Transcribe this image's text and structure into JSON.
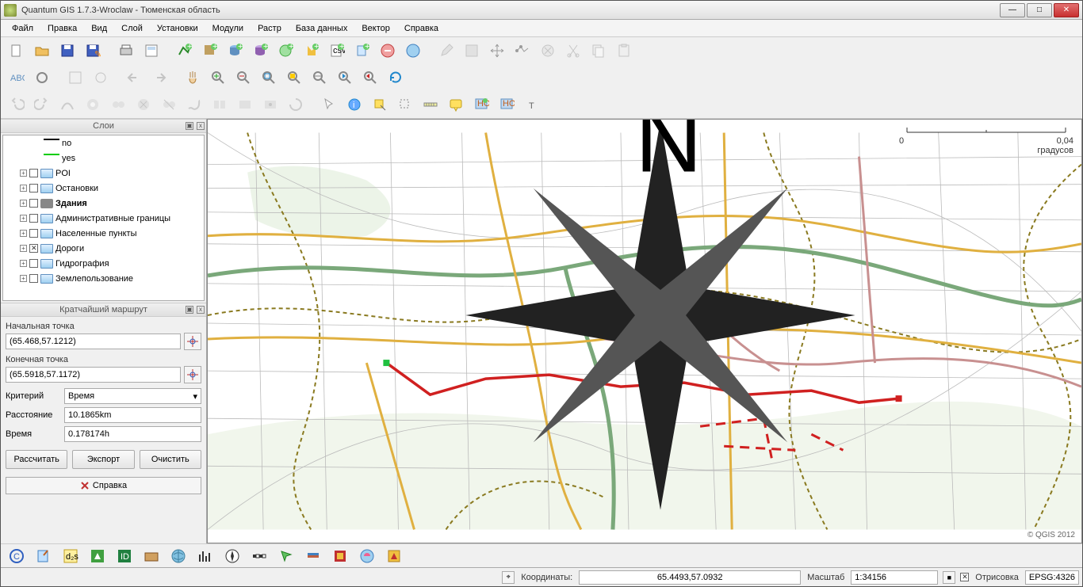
{
  "window": {
    "title": "Quantum GIS 1.7.3-Wroclaw - Тюменская область"
  },
  "menu": [
    "Файл",
    "Правка",
    "Вид",
    "Слой",
    "Установки",
    "Модули",
    "Растр",
    "База данных",
    "Вектор",
    "Справка"
  ],
  "panels": {
    "layers_title": "Слои",
    "route_title": "Кратчайший маршрут"
  },
  "layers": [
    {
      "indent": 2,
      "toggle": "",
      "check": false,
      "icon": "line-no",
      "label": "no",
      "bold": false
    },
    {
      "indent": 2,
      "toggle": "",
      "check": false,
      "icon": "line-yes",
      "label": "yes",
      "bold": false
    },
    {
      "indent": 1,
      "toggle": "+",
      "check": true,
      "icon": "folder",
      "label": "POI",
      "bold": false
    },
    {
      "indent": 1,
      "toggle": "+",
      "check": true,
      "icon": "folder",
      "label": "Остановки",
      "bold": false
    },
    {
      "indent": 1,
      "toggle": "+",
      "check": true,
      "icon": "polygon",
      "label": "Здания",
      "bold": true
    },
    {
      "indent": 1,
      "toggle": "+",
      "check": true,
      "icon": "folder",
      "label": "Административные границы",
      "bold": false
    },
    {
      "indent": 1,
      "toggle": "+",
      "check": true,
      "icon": "folder",
      "label": "Населенные пункты",
      "bold": false
    },
    {
      "indent": 1,
      "toggle": "+",
      "check": "checked",
      "icon": "folder",
      "label": "Дороги",
      "bold": false
    },
    {
      "indent": 1,
      "toggle": "+",
      "check": true,
      "icon": "folder",
      "label": "Гидрография",
      "bold": false
    },
    {
      "indent": 1,
      "toggle": "+",
      "check": true,
      "icon": "folder",
      "label": "Землепользование",
      "bold": false
    }
  ],
  "route": {
    "start_label": "Начальная точка",
    "start_value": "(65.468,57.1212)",
    "end_label": "Конечная точка",
    "end_value": "(65.5918,57.1172)",
    "criterion_label": "Критерий",
    "criterion_value": "Время",
    "distance_label": "Расстояние",
    "distance_value": "10.1865km",
    "time_label": "Время",
    "time_value": "0.178174h",
    "calc_btn": "Рассчитать",
    "export_btn": "Экспорт",
    "clear_btn": "Очистить",
    "help_btn": "Справка"
  },
  "map": {
    "scale_left": "0",
    "scale_right": "0,04",
    "scale_unit": "градусов",
    "copyright": "© QGIS 2012"
  },
  "status": {
    "coord_label": "Координаты:",
    "coord_value": "65.4493,57.0932",
    "scale_label": "Масштаб",
    "scale_value": "1:34156",
    "render_label": "Отрисовка",
    "crs": "EPSG:4326"
  },
  "icons": {
    "new": "new-file",
    "open": "open-file",
    "save": "save",
    "saveas": "save-as",
    "print": "print",
    "composer": "composer"
  }
}
